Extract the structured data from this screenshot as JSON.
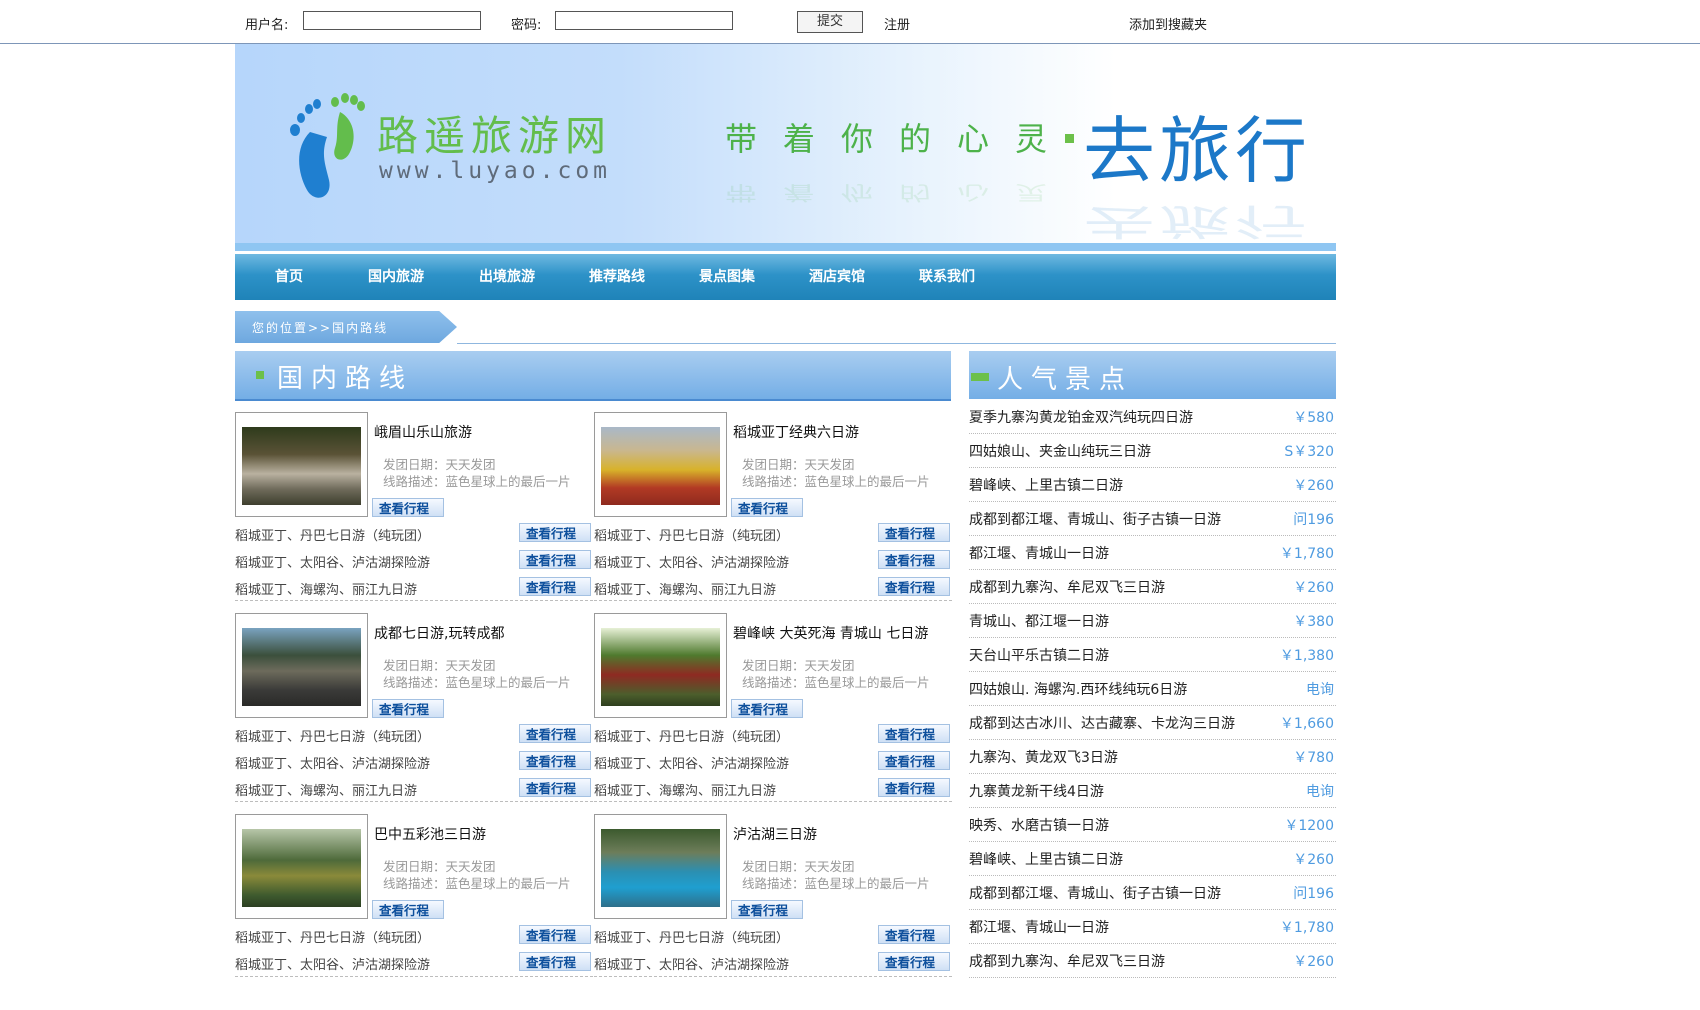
{
  "login": {
    "username_label": "用户名:",
    "password_label": "密码:",
    "username_value": "",
    "password_value": "",
    "submit_label": "提交",
    "register_label": "注册",
    "favorite_label": "添加到搜藏夹"
  },
  "banner": {
    "brand": "路遥旅游网",
    "url": "www.luyao.com",
    "slogan": "带着你的心灵",
    "big": "去旅行"
  },
  "nav": [
    "首页",
    "国内旅游",
    "出境旅游",
    "推荐路线",
    "景点图集",
    "酒店宾馆",
    "联系我们"
  ],
  "breadcrumb": "您的位置>>国内路线",
  "left_section_title": "国内路线",
  "right_section_title": "人气景点",
  "view_label": "查看行程",
  "cards": [
    {
      "title": "峨眉山乐山旅游",
      "date": "发团日期：天天发团",
      "desc": "线路描述：蓝色星球上的最后一片",
      "subs": [
        "稻城亚丁、丹巴七日游（纯玩团）",
        "稻城亚丁、太阳谷、泸沽湖探险游",
        "稻城亚丁、海螺沟、丽江九日游"
      ]
    },
    {
      "title": "稻城亚丁经典六日游",
      "date": "发团日期：天天发团",
      "desc": "线路描述：蓝色星球上的最后一片",
      "subs": [
        "稻城亚丁、丹巴七日游（纯玩团）",
        "稻城亚丁、太阳谷、泸沽湖探险游",
        "稻城亚丁、海螺沟、丽江九日游"
      ]
    },
    {
      "title": "成都七日游,玩转成都",
      "date": "发团日期：天天发团",
      "desc": "线路描述：蓝色星球上的最后一片",
      "subs": [
        "稻城亚丁、丹巴七日游（纯玩团）",
        "稻城亚丁、太阳谷、泸沽湖探险游",
        "稻城亚丁、海螺沟、丽江九日游"
      ]
    },
    {
      "title": "碧峰峡 大英死海 青城山 七日游",
      "date": "发团日期：天天发团",
      "desc": "线路描述：蓝色星球上的最后一片",
      "subs": [
        "稻城亚丁、丹巴七日游（纯玩团）",
        "稻城亚丁、太阳谷、泸沽湖探险游",
        "稻城亚丁、海螺沟、丽江九日游"
      ]
    },
    {
      "title": "巴中五彩池三日游",
      "date": "发团日期：天天发团",
      "desc": "线路描述：蓝色星球上的最后一片",
      "subs": [
        "稻城亚丁、丹巴七日游（纯玩团）",
        "稻城亚丁、太阳谷、泸沽湖探险游",
        ""
      ]
    },
    {
      "title": "泸沽湖三日游",
      "date": "发团日期：天天发团",
      "desc": "线路描述：蓝色星球上的最后一片",
      "subs": [
        "稻城亚丁、丹巴七日游（纯玩团）",
        "稻城亚丁、太阳谷、泸沽湖探险游",
        ""
      ]
    }
  ],
  "popular": [
    {
      "name": "夏季九寨沟黄龙铂金双汽纯玩四日游",
      "price": "￥580"
    },
    {
      "name": "四姑娘山、夹金山纯玩三日游",
      "price": "S￥320"
    },
    {
      "name": "碧峰峡、上里古镇二日游",
      "price": "￥260"
    },
    {
      "name": "成都到都江堰、青城山、街子古镇一日游",
      "price": "问196"
    },
    {
      "name": "都江堰、青城山一日游",
      "price": "￥1,780"
    },
    {
      "name": "成都到九寨沟、牟尼双飞三日游",
      "price": "￥260"
    },
    {
      "name": "青城山、都江堰一日游",
      "price": "￥380"
    },
    {
      "name": "天台山平乐古镇二日游",
      "price": "￥1,380"
    },
    {
      "name": "四姑娘山. 海螺沟.西环线纯玩6日游",
      "price": "电询"
    },
    {
      "name": "成都到达古冰川、达古藏寨、卡龙沟三日游",
      "price": "￥1,660"
    },
    {
      "name": "九寨沟、黄龙双飞3日游",
      "price": "￥780"
    },
    {
      "name": "九寨黄龙新干线4日游",
      "price": "电询"
    },
    {
      "name": "映秀、水磨古镇一日游",
      "price": "￥1200"
    },
    {
      "name": "碧峰峡、上里古镇二日游",
      "price": "￥260"
    },
    {
      "name": "成都到都江堰、青城山、街子古镇一日游",
      "price": "问196"
    },
    {
      "name": "都江堰、青城山一日游",
      "price": "￥1,780"
    },
    {
      "name": "成都到九寨沟、牟尼双飞三日游",
      "price": "￥260"
    }
  ]
}
